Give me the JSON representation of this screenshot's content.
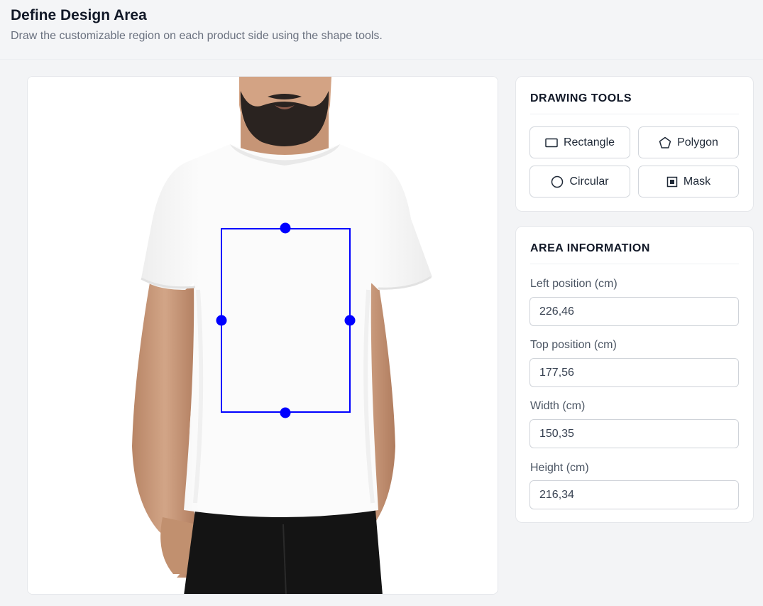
{
  "header": {
    "title": "Define Design Area",
    "subtitle": "Draw the customizable region on each product side using the shape tools."
  },
  "tools": {
    "title": "DRAWING TOOLS",
    "buttons": [
      {
        "label": "Rectangle",
        "icon": "rectangle-icon"
      },
      {
        "label": "Polygon",
        "icon": "pentagon-icon"
      },
      {
        "label": "Circular",
        "icon": "circle-icon"
      },
      {
        "label": "Mask",
        "icon": "mask-icon"
      }
    ]
  },
  "area_info": {
    "title": "AREA INFORMATION",
    "fields": [
      {
        "label": "Left position (cm)",
        "value": "226,46"
      },
      {
        "label": "Top position (cm)",
        "value": "177,56"
      },
      {
        "label": "Width (cm)",
        "value": "150,35"
      },
      {
        "label": "Height (cm)",
        "value": "216,34"
      }
    ]
  },
  "colors": {
    "selection": "#0000ff",
    "tshirt": "#fbfbfb",
    "skin": "#c99a7c",
    "pants": "#141414"
  }
}
